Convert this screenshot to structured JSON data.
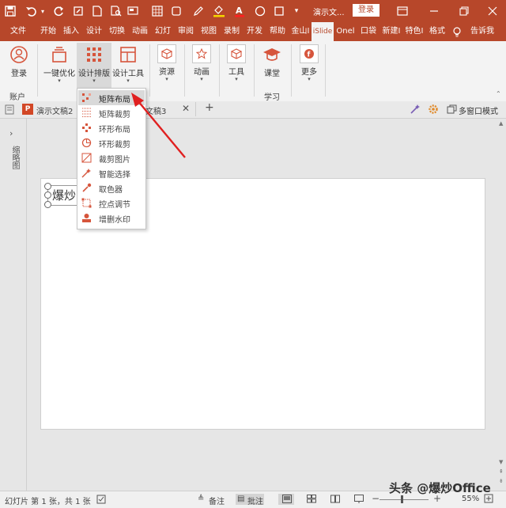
{
  "colors": {
    "brand": "#b7472a",
    "arrow": "#e02020"
  },
  "title_bar": {
    "quick_icons": [
      "save-icon",
      "undo-icon",
      "redo-icon",
      "format-painter-icon",
      "new-file-icon",
      "print-preview-icon",
      "slide-layout-icon",
      "grid-icon",
      "shape-icon",
      "pen-icon",
      "fill-color-icon",
      "font-color-icon",
      "eyedropper-icon",
      "circle-icon",
      "square-icon",
      "customize-icon"
    ],
    "doc_title": "演示文...",
    "login": "登录"
  },
  "tabs": [
    "文件",
    "开始",
    "插入",
    "设计",
    "切换",
    "动画",
    "幻灯",
    "审阅",
    "视图",
    "录制",
    "开发",
    "帮助",
    "金山I",
    "iSlide",
    "Onel",
    "口袋",
    "新建I",
    "特色I",
    "格式",
    "告诉我"
  ],
  "ribbon": {
    "login": "登录",
    "account_group": "账户",
    "one_click": "一键优化",
    "design_layout": "设计排版",
    "design_tools": "设计工具",
    "resources": "资源",
    "animation": "动画",
    "tools": "工具",
    "course": "课堂",
    "more": "更多",
    "learn_group": "学习"
  },
  "doc_tabs": {
    "tab1": "演示文稿2",
    "tab2": "文稿3",
    "multi_window": "多窗口模式"
  },
  "left_pane": {
    "label": "缩略图"
  },
  "slide": {
    "text": "爆炒"
  },
  "dropdown": [
    {
      "label": "矩阵布局",
      "icon": "matrix-layout-icon"
    },
    {
      "label": "矩阵裁剪",
      "icon": "matrix-crop-icon"
    },
    {
      "label": "环形布局",
      "icon": "ring-layout-icon"
    },
    {
      "label": "环形裁剪",
      "icon": "ring-crop-icon"
    },
    {
      "label": "裁剪图片",
      "icon": "crop-image-icon"
    },
    {
      "label": "智能选择",
      "icon": "smart-select-icon"
    },
    {
      "label": "取色器",
      "icon": "eyedropper-icon"
    },
    {
      "label": "控点调节",
      "icon": "handle-adjust-icon"
    },
    {
      "label": "增删水印",
      "icon": "watermark-icon"
    }
  ],
  "status": {
    "slide_info": "幻灯片 第 1 张，共 1 张",
    "notes": "备注",
    "comments": "批注",
    "zoom": "55%"
  },
  "watermark": "头条 @爆炒Office"
}
